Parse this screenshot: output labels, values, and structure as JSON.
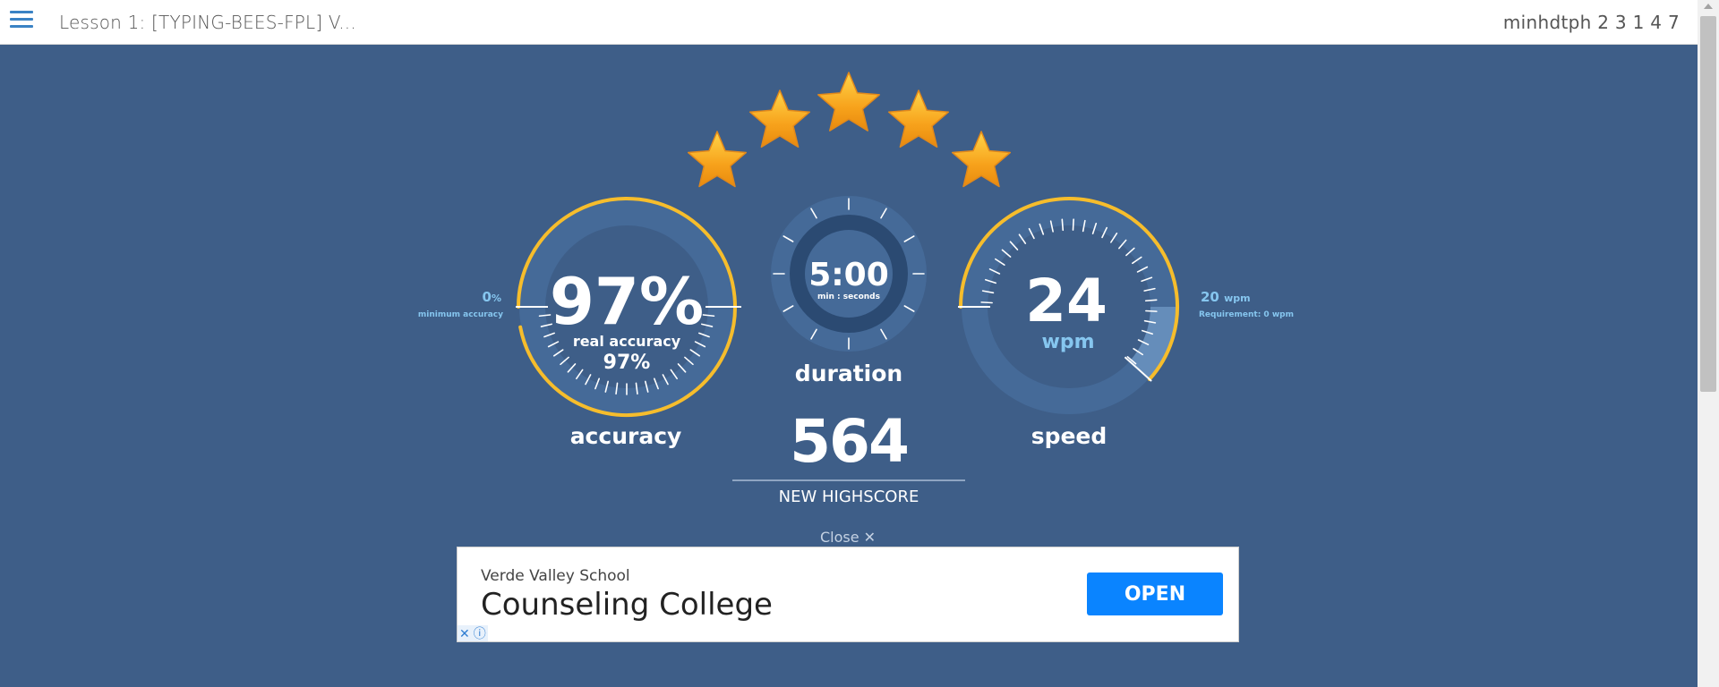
{
  "header": {
    "lesson_title": "Lesson 1: [TYPING-BEES-FPL] V...",
    "username": "minhdtph 2 3 1 4 7"
  },
  "results": {
    "stars": {
      "earned": 5,
      "total": 5
    },
    "accuracy": {
      "value": "97%",
      "real_label": "real accuracy",
      "real_value": "97%",
      "label": "accuracy",
      "min_value": "0",
      "min_unit": "%",
      "min_label": "minimum accuracy",
      "fraction": 0.97
    },
    "duration": {
      "value": "5:00",
      "unit": "min : seconds",
      "label": "duration"
    },
    "speed": {
      "value": "24",
      "unit": "wpm",
      "label": "speed",
      "requirement_value": "20",
      "requirement_unit": "wpm",
      "requirement_label": "Requirement: 0 wpm"
    },
    "highscore": {
      "value": "564",
      "label": "NEW HIGHSCORE"
    }
  },
  "ad": {
    "close_label": "Close ✕",
    "sponsor": "Verde Valley School",
    "headline": "Counseling College",
    "cta": "OPEN",
    "badge_close": "✕",
    "badge_info": "ⓘ"
  },
  "colors": {
    "background": "#3e5e88",
    "gauge_ring": "#f6bd2c",
    "dial_dark": "#2b4a72",
    "dial_mid": "#456a98",
    "cta": "#0a84ff"
  },
  "icons": [
    "menu-icon",
    "star-icon",
    "close-icon",
    "info-icon"
  ]
}
